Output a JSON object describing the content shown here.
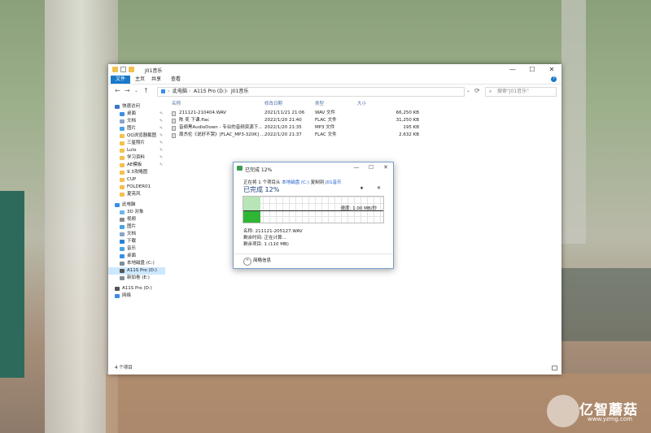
{
  "window": {
    "title": "J01音乐",
    "controls": [
      "—",
      "☐",
      "✕"
    ]
  },
  "ribbon": {
    "tabs": [
      "文件",
      "主页",
      "共享",
      "查看"
    ],
    "help": "?"
  },
  "address": {
    "back": "←",
    "forward": "→",
    "recent": "⌄",
    "up": "↑",
    "segments": [
      "此电脑",
      "A11S Pro (D:)",
      "J01音乐"
    ],
    "separator": "›",
    "dropdown": "⌄",
    "refresh": "⟳",
    "search_placeholder": "搜索\"J01音乐\""
  },
  "sidebar": {
    "items": [
      {
        "label": "快速访问",
        "color": "#3f78c8",
        "pin": false
      },
      {
        "label": "桌面",
        "color": "#3a8ee6",
        "pin": true
      },
      {
        "label": "文档",
        "color": "#8aa4c8",
        "pin": true
      },
      {
        "label": "图片",
        "color": "#4aa3df",
        "pin": true
      },
      {
        "label": "QQ浏览器截图",
        "color": "#f2c14e",
        "pin": true
      },
      {
        "label": "三星照片",
        "color": "#f2c14e",
        "pin": true
      },
      {
        "label": "Luts",
        "color": "#f2c14e",
        "pin": true
      },
      {
        "label": "学习资料",
        "color": "#f2c14e",
        "pin": true
      },
      {
        "label": "AE模板",
        "color": "#f2c14e",
        "pin": true
      },
      {
        "label": "9.3攻略图",
        "color": "#f2c14e",
        "pin": false
      },
      {
        "label": "CUP",
        "color": "#f2c14e",
        "pin": false
      },
      {
        "label": "FOLDER01",
        "color": "#f2c14e",
        "pin": false
      },
      {
        "label": "夏亮风",
        "color": "#f2c14e",
        "pin": false
      },
      {
        "label": "此电脑",
        "color": "#3a8ee6",
        "pin": false
      },
      {
        "label": "3D 对象",
        "color": "#6fb7e6",
        "pin": false
      },
      {
        "label": "视频",
        "color": "#8a8a8a",
        "pin": false
      },
      {
        "label": "图片",
        "color": "#4aa3df",
        "pin": false
      },
      {
        "label": "文档",
        "color": "#8aa4c8",
        "pin": false
      },
      {
        "label": "下载",
        "color": "#2f7fd6",
        "pin": false
      },
      {
        "label": "音乐",
        "color": "#4aa3df",
        "pin": false
      },
      {
        "label": "桌面",
        "color": "#3a8ee6",
        "pin": false
      },
      {
        "label": "本地磁盘 (C:)",
        "color": "#7f8c99",
        "pin": false
      },
      {
        "label": "A11S Pro (D:)",
        "color": "#555555",
        "pin": false
      },
      {
        "label": "新加卷 (E:)",
        "color": "#7f8c99",
        "pin": false
      },
      {
        "label": "A11S Pro (D:)",
        "color": "#555555",
        "pin": false
      },
      {
        "label": "网络",
        "color": "#3a8ee6",
        "pin": false
      }
    ],
    "pin_glyph": "✎"
  },
  "files": {
    "columns": [
      "名称",
      "修改日期",
      "类型",
      "大小"
    ],
    "rows": [
      {
        "name": "211121-210404.WAV",
        "date": "2021/11/21 21:06",
        "type": "WAV 文件",
        "size": "66,250 KB"
      },
      {
        "name": "陈 奕 下课.flac",
        "date": "2022/1/20 21:40",
        "type": "FLAC 文件",
        "size": "31,250 KB"
      },
      {
        "name": "音频黑AudioDown - 专业的音频资源下...",
        "date": "2022/1/20 21:35",
        "type": "MP3 文件",
        "size": "195 KB"
      },
      {
        "name": "周杰伦《说好不哭》[FLAC_MP3-320K] ...",
        "date": "2022/1/20 21:37",
        "type": "FLAC 文件",
        "size": "2,632 KB"
      }
    ]
  },
  "status": {
    "count": "4 个项目"
  },
  "copy_dialog": {
    "title": "已完成 12%",
    "controls": [
      "—",
      "☐",
      "✕"
    ],
    "line_prefix": "正在将 1 个项目从",
    "source": "本地磁盘 (C:)",
    "line_mid": "复制到",
    "dest": "J01音乐",
    "heading": "已完成 12%",
    "pause": "⏸",
    "cancel": "✕",
    "progress": 0.12,
    "speed": "速度: 1.00 MB/秒",
    "name_line": "名称: 211121-205127.WAV",
    "remaining_time": "剩余时间: 正在计算...",
    "remaining_items": "剩余项目: 1 (110 MB)",
    "details_label": "简略信息",
    "details_chevron": "^"
  },
  "watermark": {
    "text": "亿智蘑菇",
    "url": "www.yzmg.com"
  }
}
